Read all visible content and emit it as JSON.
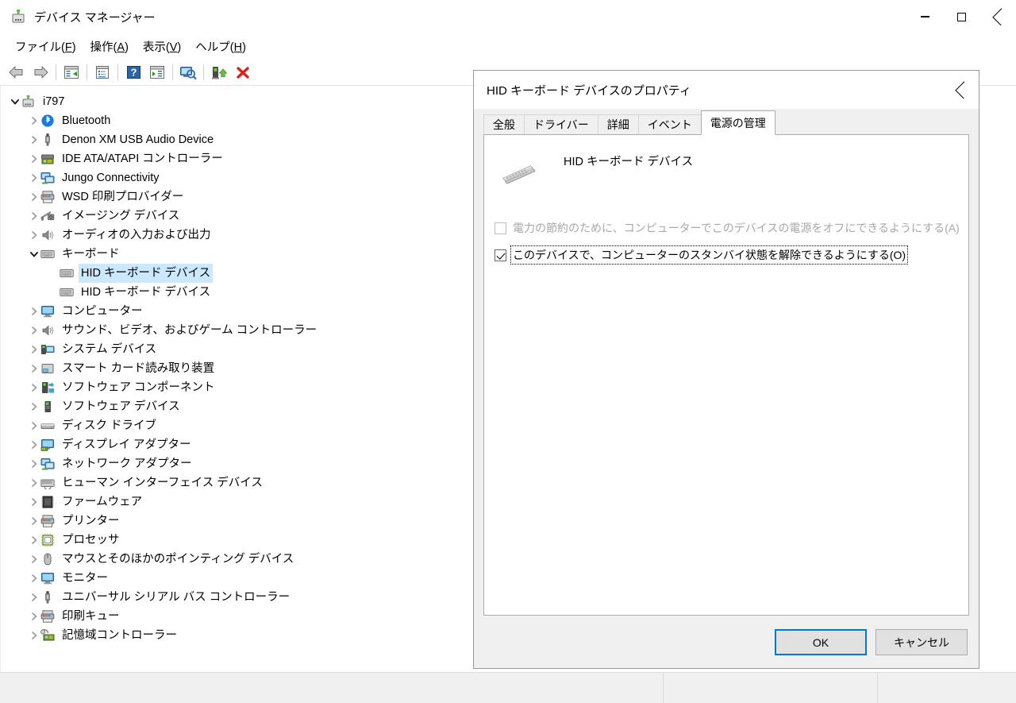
{
  "window": {
    "title": "デバイス マネージャー",
    "icon": "device-manager-icon",
    "minimize_label": "最小化",
    "maximize_label": "最大化",
    "close_label": "閉じる"
  },
  "menubar": {
    "items": [
      {
        "label": "ファイル(F)",
        "text": "ファイル(",
        "accel": "F",
        "tail": ")"
      },
      {
        "label": "操作(A)",
        "text": "操作(",
        "accel": "A",
        "tail": ")"
      },
      {
        "label": "表示(V)",
        "text": "表示(",
        "accel": "V",
        "tail": ")"
      },
      {
        "label": "ヘルプ(H)",
        "text": "ヘルプ(",
        "accel": "H",
        "tail": ")"
      }
    ]
  },
  "toolbar": {
    "buttons": [
      {
        "name": "back-icon"
      },
      {
        "name": "forward-icon"
      },
      {
        "name": "separator"
      },
      {
        "name": "show-hide-console-tree-icon"
      },
      {
        "name": "separator"
      },
      {
        "name": "properties-icon"
      },
      {
        "name": "separator"
      },
      {
        "name": "help-icon"
      },
      {
        "name": "update-driver-icon"
      },
      {
        "name": "separator"
      },
      {
        "name": "scan-hardware-changes-icon"
      },
      {
        "name": "separator"
      },
      {
        "name": "enable-device-icon"
      },
      {
        "name": "uninstall-device-icon"
      }
    ]
  },
  "tree": {
    "root": {
      "label": "i797",
      "icon": "computer-icon",
      "expanded": true
    },
    "items": [
      {
        "label": "Bluetooth",
        "icon": "bluetooth-icon",
        "depth": 1,
        "expanded": false,
        "selected": false
      },
      {
        "label": "Denon XM USB Audio Device",
        "icon": "usb-icon",
        "depth": 1,
        "expanded": false,
        "selected": false
      },
      {
        "label": "IDE ATA/ATAPI コントローラー",
        "icon": "ide-controller-icon",
        "depth": 1,
        "expanded": false,
        "selected": false
      },
      {
        "label": "Jungo Connectivity",
        "icon": "network-icon",
        "depth": 1,
        "expanded": false,
        "selected": false
      },
      {
        "label": "WSD 印刷プロバイダー",
        "icon": "printer-icon",
        "depth": 1,
        "expanded": false,
        "selected": false
      },
      {
        "label": "イメージング デバイス",
        "icon": "imaging-device-icon",
        "depth": 1,
        "expanded": false,
        "selected": false
      },
      {
        "label": "オーディオの入力および出力",
        "icon": "speaker-icon",
        "depth": 1,
        "expanded": false,
        "selected": false
      },
      {
        "label": "キーボード",
        "icon": "keyboard-icon",
        "depth": 1,
        "expanded": true,
        "selected": false
      },
      {
        "label": "HID キーボード デバイス",
        "icon": "keyboard-icon",
        "depth": 2,
        "expanded": false,
        "selected": true
      },
      {
        "label": "HID キーボード デバイス",
        "icon": "keyboard-icon",
        "depth": 2,
        "expanded": false,
        "selected": false
      },
      {
        "label": "コンピューター",
        "icon": "monitor-icon",
        "depth": 1,
        "expanded": false,
        "selected": false
      },
      {
        "label": "サウンド、ビデオ、およびゲーム コントローラー",
        "icon": "speaker-icon",
        "depth": 1,
        "expanded": false,
        "selected": false
      },
      {
        "label": "システム デバイス",
        "icon": "system-device-icon",
        "depth": 1,
        "expanded": false,
        "selected": false
      },
      {
        "label": "スマート カード読み取り装置",
        "icon": "smart-card-reader-icon",
        "depth": 1,
        "expanded": false,
        "selected": false
      },
      {
        "label": "ソフトウェア コンポーネント",
        "icon": "software-component-icon",
        "depth": 1,
        "expanded": false,
        "selected": false
      },
      {
        "label": "ソフトウェア デバイス",
        "icon": "software-device-icon",
        "depth": 1,
        "expanded": false,
        "selected": false
      },
      {
        "label": "ディスク ドライブ",
        "icon": "disk-drive-icon",
        "depth": 1,
        "expanded": false,
        "selected": false
      },
      {
        "label": "ディスプレイ アダプター",
        "icon": "display-adapter-icon",
        "depth": 1,
        "expanded": false,
        "selected": false
      },
      {
        "label": "ネットワーク アダプター",
        "icon": "network-adapter-icon",
        "depth": 1,
        "expanded": false,
        "selected": false
      },
      {
        "label": "ヒューマン インターフェイス デバイス",
        "icon": "hid-icon",
        "depth": 1,
        "expanded": false,
        "selected": false
      },
      {
        "label": "ファームウェア",
        "icon": "firmware-icon",
        "depth": 1,
        "expanded": false,
        "selected": false
      },
      {
        "label": "プリンター",
        "icon": "printer-icon",
        "depth": 1,
        "expanded": false,
        "selected": false
      },
      {
        "label": "プロセッサ",
        "icon": "processor-icon",
        "depth": 1,
        "expanded": false,
        "selected": false
      },
      {
        "label": "マウスとそのほかのポインティング デバイス",
        "icon": "mouse-icon",
        "depth": 1,
        "expanded": false,
        "selected": false
      },
      {
        "label": "モニター",
        "icon": "monitor-icon",
        "depth": 1,
        "expanded": false,
        "selected": false
      },
      {
        "label": "ユニバーサル シリアル バス コントローラー",
        "icon": "usb-icon",
        "depth": 1,
        "expanded": false,
        "selected": false
      },
      {
        "label": "印刷キュー",
        "icon": "printer-icon",
        "depth": 1,
        "expanded": false,
        "selected": false
      },
      {
        "label": "記憶域コントローラー",
        "icon": "storage-controller-icon",
        "depth": 1,
        "expanded": false,
        "selected": false
      }
    ]
  },
  "statusbar": {
    "pane1": "",
    "pane2": "",
    "pane3": ""
  },
  "dialog": {
    "title": "HID キーボード デバイスのプロパティ",
    "close_label": "閉じる",
    "tabs": [
      {
        "label": "全般",
        "active": false
      },
      {
        "label": "ドライバー",
        "active": false
      },
      {
        "label": "詳細",
        "active": false
      },
      {
        "label": "イベント",
        "active": false
      },
      {
        "label": "電源の管理",
        "active": true
      }
    ],
    "device_name": "HID キーボード デバイス",
    "device_icon": "keyboard-icon",
    "checkboxes": [
      {
        "label": "電力の節約のために、コンピューターでこのデバイスの電源をオフにできるようにする(A)",
        "checked": false,
        "disabled": true,
        "focused": false,
        "accel": "A"
      },
      {
        "label": "このデバイスで、コンピューターのスタンバイ状態を解除できるようにする(O)",
        "checked": true,
        "disabled": false,
        "focused": true,
        "accel": "O"
      }
    ],
    "buttons": {
      "ok": "OK",
      "cancel": "キャンセル"
    }
  },
  "colors": {
    "selection": "#cce8ff",
    "accent": "#0078d7",
    "chrome": "#f0f0f0",
    "danger": "#e81123"
  }
}
